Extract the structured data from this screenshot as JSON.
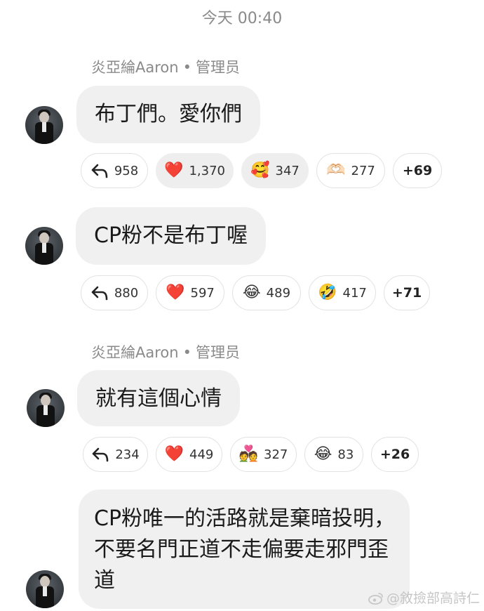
{
  "timestamp": "今天 00:40",
  "messages": [
    {
      "sender": {
        "name": "炎亞綸Aaron",
        "separator": "•",
        "role": "管理员"
      },
      "text": "布丁們。愛你們",
      "reactions": {
        "reply_count": "958",
        "items": [
          {
            "emoji": "❤️",
            "icon": "red-heart-icon",
            "count": "1,370"
          },
          {
            "emoji": "🥰",
            "icon": "smiling-face-with-hearts-icon",
            "count": "347"
          },
          {
            "emoji": "🫶🏻",
            "icon": "heart-hands-icon",
            "count": "277"
          }
        ],
        "more": "+69"
      }
    },
    {
      "text": "CP粉不是布丁喔",
      "reactions": {
        "reply_count": "880",
        "items": [
          {
            "emoji": "❤️",
            "icon": "red-heart-icon",
            "count": "597"
          },
          {
            "emoji": "😂",
            "icon": "tears-of-joy-icon",
            "count": "489"
          },
          {
            "emoji": "🤣",
            "icon": "rolling-on-floor-laughing-icon",
            "count": "417"
          }
        ],
        "more": "+71"
      }
    },
    {
      "sender": {
        "name": "炎亞綸Aaron",
        "separator": "•",
        "role": "管理员"
      },
      "text": "就有這個心情",
      "reactions": {
        "reply_count": "234",
        "items": [
          {
            "emoji": "❤️",
            "icon": "red-heart-icon",
            "count": "449"
          },
          {
            "emoji": "💑",
            "icon": "couple-with-heart-icon",
            "count": "327"
          },
          {
            "emoji": "😂",
            "icon": "tears-of-joy-icon",
            "count": "83"
          }
        ],
        "more": "+26"
      }
    },
    {
      "text_lines": [
        "CP粉唯一的活路就是棄暗投明，",
        "不要名門正道不走偏要走邪門歪",
        "道"
      ]
    }
  ],
  "watermark": "@敘撿部高詩仁",
  "colors": {
    "bubble": "#f0f0f0",
    "meta_text": "#8a8a8a",
    "chip_border": "#e2e2e2"
  }
}
